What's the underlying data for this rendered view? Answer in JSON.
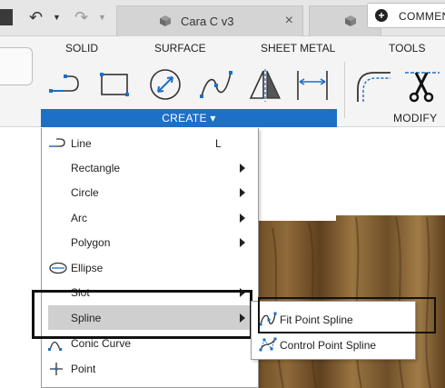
{
  "topbar": {
    "undo_icon": "undo-icon",
    "redo_icon": "redo-icon",
    "tabs": [
      {
        "title": "Cara C v3",
        "icon": "cube-icon",
        "close": "×"
      },
      {
        "title": "",
        "icon": "cube-icon"
      }
    ],
    "comments_label": "COMMEN"
  },
  "ribbon": {
    "tabs": [
      "SOLID",
      "SURFACE",
      "SHEET METAL",
      "TOOLS"
    ],
    "create_label": "CREATE ▾",
    "modify_label": "MODIFY ▾",
    "create_tools": [
      "line-icon",
      "rectangle-icon",
      "circle-icon",
      "spline-icon",
      "mirror-icon",
      "dimension-icon"
    ],
    "modify_tools": [
      "fillet-icon",
      "trim-icon"
    ],
    "accent_color": "#1e6fc6"
  },
  "create_menu": {
    "items": [
      {
        "label": "Line",
        "shortcut": "L",
        "icon": "line-icon"
      },
      {
        "label": "Rectangle",
        "submenu": true
      },
      {
        "label": "Circle",
        "submenu": true
      },
      {
        "label": "Arc",
        "submenu": true
      },
      {
        "label": "Polygon",
        "submenu": true
      },
      {
        "label": "Ellipse",
        "icon": "ellipse-icon"
      },
      {
        "label": "Slot",
        "submenu": true
      },
      {
        "label": "Spline",
        "submenu": true,
        "highlighted": true
      },
      {
        "label": "Conic Curve",
        "icon": "conic-curve-icon"
      },
      {
        "label": "Point",
        "icon": "point-icon"
      }
    ]
  },
  "spline_submenu": {
    "items": [
      {
        "label": "Fit Point Spline",
        "icon": "fit-point-spline-icon"
      },
      {
        "label": "Control Point Spline",
        "icon": "control-point-spline-icon"
      }
    ]
  }
}
